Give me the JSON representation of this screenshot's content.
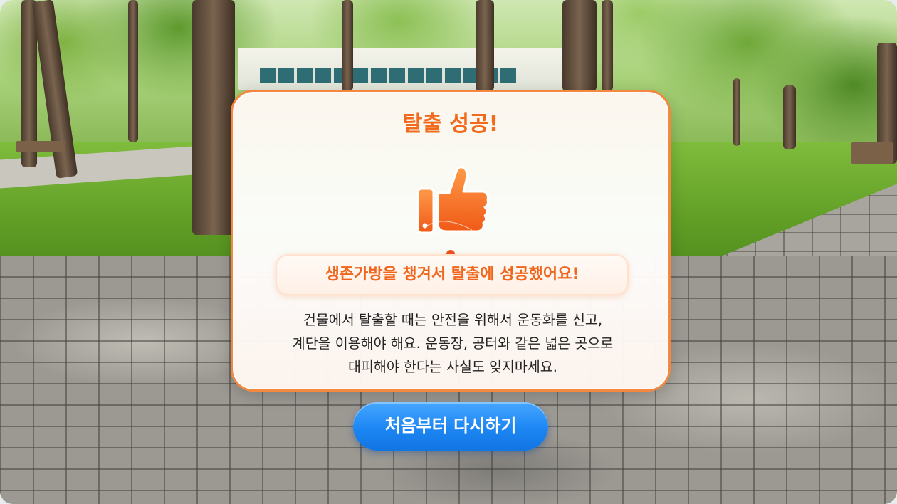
{
  "dialog": {
    "title": "탈출 성공!",
    "icon": "thumbs-up-icon",
    "subtitle": "생존가방을 챙겨서 탈출에 성공했어요!",
    "description_lines": [
      "건물에서 탈출할 때는 안전을 위해서 운동화를 신고,",
      "계단을 이용해야 해요. 운동장, 공터와 같은 넓은 곳으로",
      "대피해야 한다는 사실도 잊지마세요."
    ]
  },
  "actions": {
    "restart_label": "처음부터 다시하기"
  },
  "colors": {
    "accent": "#f26b1d",
    "card_border": "#f4883f",
    "button": "#1c86f3"
  }
}
